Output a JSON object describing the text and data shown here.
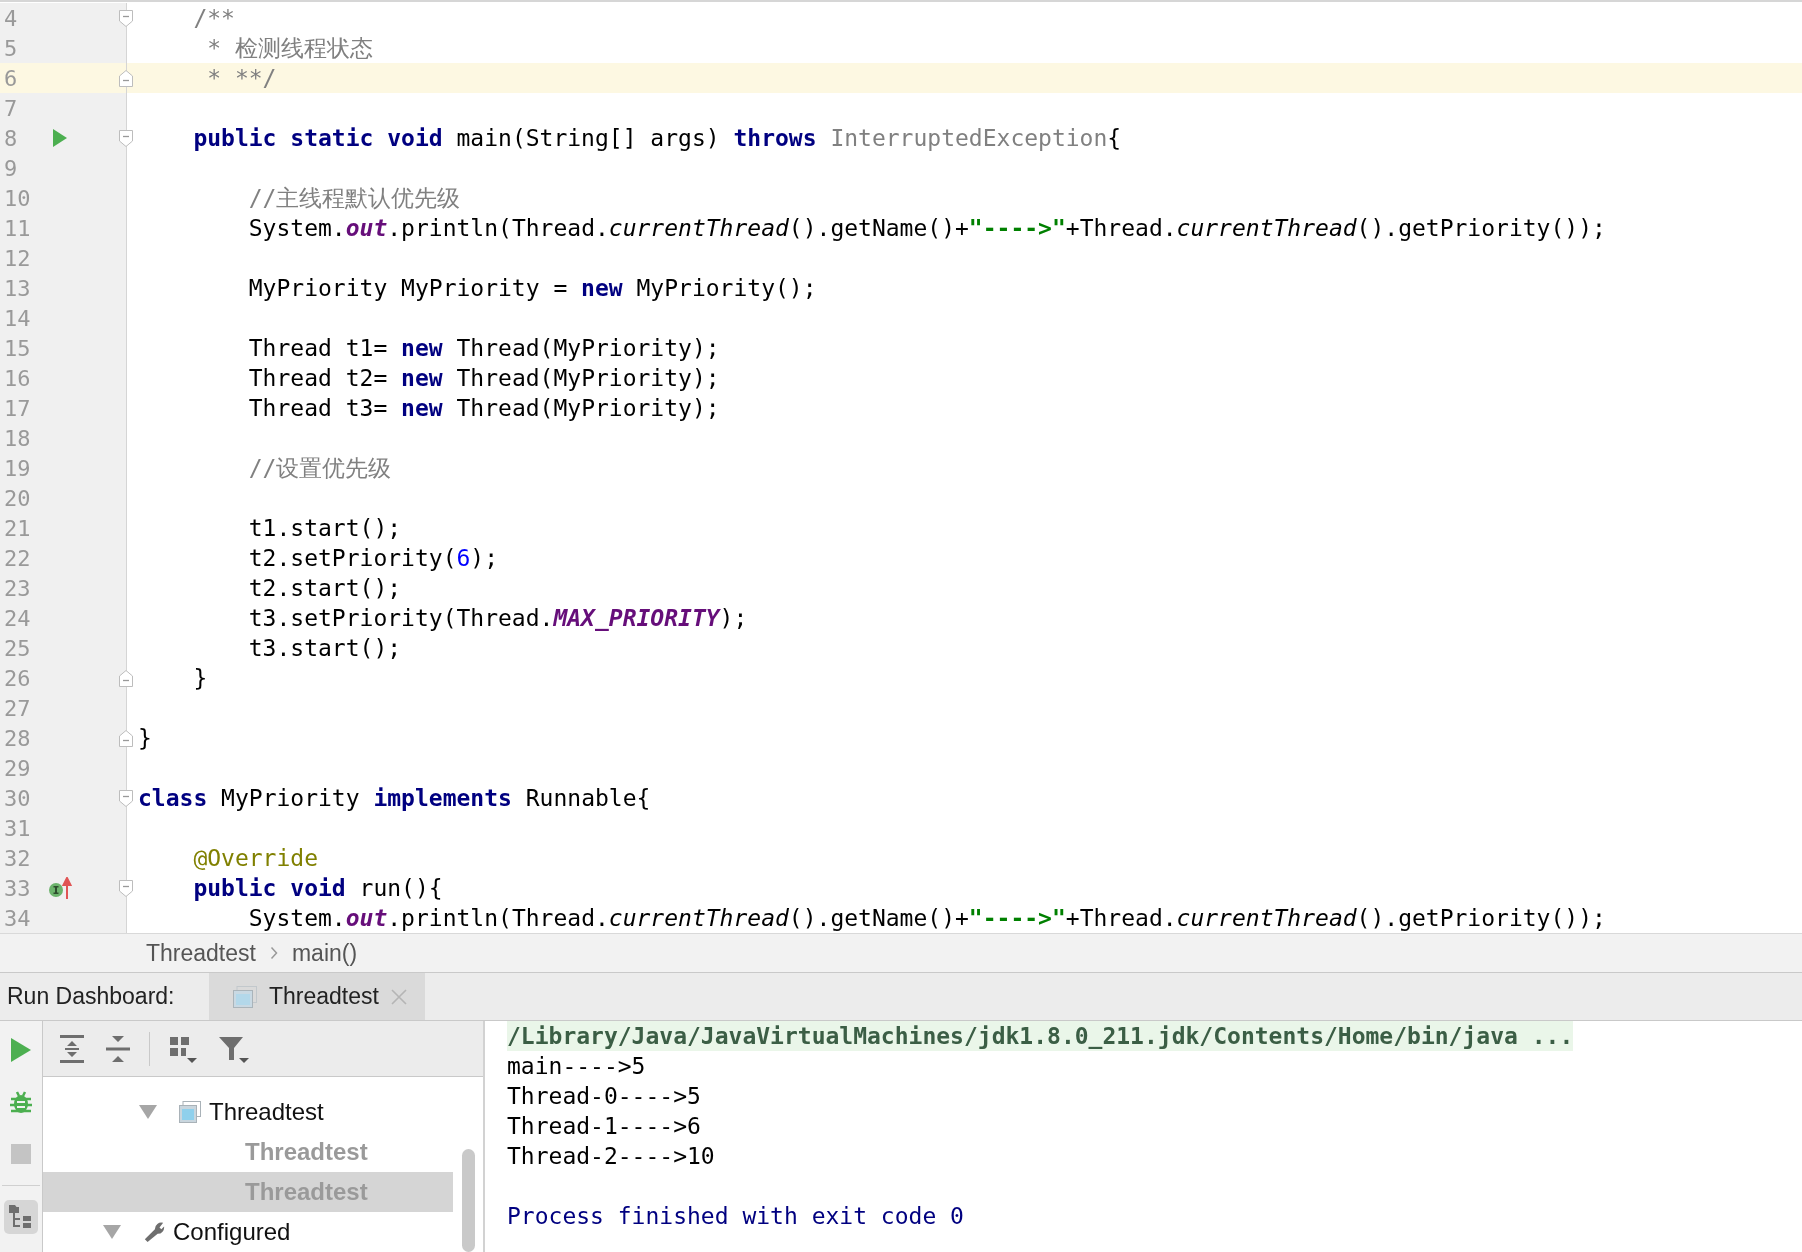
{
  "editor": {
    "lines": [
      {
        "number": "4",
        "fold_start": true,
        "fold_end": false,
        "run_marker": false,
        "implements_marker": false,
        "current": false,
        "tokens": [
          {
            "kind": "comment",
            "text": "    /**"
          }
        ]
      },
      {
        "number": "5",
        "fold_start": false,
        "fold_end": false,
        "run_marker": false,
        "implements_marker": false,
        "current": false,
        "tokens": [
          {
            "kind": "comment",
            "text": "     * 检测线程状态"
          }
        ]
      },
      {
        "number": "6",
        "fold_start": false,
        "fold_end": true,
        "run_marker": false,
        "implements_marker": false,
        "current": true,
        "tokens": [
          {
            "kind": "comment",
            "text": "     * **/"
          }
        ]
      },
      {
        "number": "7",
        "fold_start": false,
        "fold_end": false,
        "run_marker": false,
        "implements_marker": false,
        "current": false
      },
      {
        "number": "8",
        "fold_start": true,
        "fold_end": false,
        "run_marker": true,
        "implements_marker": false,
        "current": false,
        "tokens": [
          {
            "kind": "keyword",
            "text": "    public static void"
          },
          {
            "kind": "plain",
            "text": " main(String[] args) "
          },
          {
            "kind": "keyword",
            "text": "throws "
          },
          {
            "kind": "unused",
            "text": "InterruptedException"
          },
          {
            "kind": "plain",
            "text": "{"
          }
        ]
      },
      {
        "number": "9",
        "fold_start": false,
        "fold_end": false,
        "run_marker": false,
        "implements_marker": false,
        "current": false
      },
      {
        "number": "10",
        "fold_start": false,
        "fold_end": false,
        "run_marker": false,
        "implements_marker": false,
        "current": false,
        "tokens": [
          {
            "kind": "comment",
            "text": "        //主线程默认优先级"
          }
        ]
      },
      {
        "number": "11",
        "fold_start": false,
        "fold_end": false,
        "run_marker": false,
        "implements_marker": false,
        "current": false,
        "tokens": [
          {
            "kind": "plain",
            "text": "        System."
          },
          {
            "kind": "field",
            "text": "out"
          },
          {
            "kind": "plain",
            "text": ".println(Thread."
          },
          {
            "kind": "static",
            "text": "currentThread"
          },
          {
            "kind": "plain",
            "text": "().getName()+"
          },
          {
            "kind": "string",
            "text": "\"---->\""
          },
          {
            "kind": "plain",
            "text": "+Thread."
          },
          {
            "kind": "static",
            "text": "currentThread"
          },
          {
            "kind": "plain",
            "text": "().getPriority());"
          }
        ]
      },
      {
        "number": "12",
        "fold_start": false,
        "fold_end": false,
        "run_marker": false,
        "implements_marker": false,
        "current": false
      },
      {
        "number": "13",
        "fold_start": false,
        "fold_end": false,
        "run_marker": false,
        "implements_marker": false,
        "current": false,
        "tokens": [
          {
            "kind": "plain",
            "text": "        MyPriority MyPriority = "
          },
          {
            "kind": "keyword",
            "text": "new"
          },
          {
            "kind": "plain",
            "text": " MyPriority();"
          }
        ]
      },
      {
        "number": "14",
        "fold_start": false,
        "fold_end": false,
        "run_marker": false,
        "implements_marker": false,
        "current": false
      },
      {
        "number": "15",
        "fold_start": false,
        "fold_end": false,
        "run_marker": false,
        "implements_marker": false,
        "current": false,
        "tokens": [
          {
            "kind": "plain",
            "text": "        Thread t1= "
          },
          {
            "kind": "keyword",
            "text": "new"
          },
          {
            "kind": "plain",
            "text": " Thread(MyPriority);"
          }
        ]
      },
      {
        "number": "16",
        "fold_start": false,
        "fold_end": false,
        "run_marker": false,
        "implements_marker": false,
        "current": false,
        "tokens": [
          {
            "kind": "plain",
            "text": "        Thread t2= "
          },
          {
            "kind": "keyword",
            "text": "new"
          },
          {
            "kind": "plain",
            "text": " Thread(MyPriority);"
          }
        ]
      },
      {
        "number": "17",
        "fold_start": false,
        "fold_end": false,
        "run_marker": false,
        "implements_marker": false,
        "current": false,
        "tokens": [
          {
            "kind": "plain",
            "text": "        Thread t3= "
          },
          {
            "kind": "keyword",
            "text": "new"
          },
          {
            "kind": "plain",
            "text": " Thread(MyPriority);"
          }
        ]
      },
      {
        "number": "18",
        "fold_start": false,
        "fold_end": false,
        "run_marker": false,
        "implements_marker": false,
        "current": false
      },
      {
        "number": "19",
        "fold_start": false,
        "fold_end": false,
        "run_marker": false,
        "implements_marker": false,
        "current": false,
        "tokens": [
          {
            "kind": "comment",
            "text": "        //设置优先级"
          }
        ]
      },
      {
        "number": "20",
        "fold_start": false,
        "fold_end": false,
        "run_marker": false,
        "implements_marker": false,
        "current": false
      },
      {
        "number": "21",
        "fold_start": false,
        "fold_end": false,
        "run_marker": false,
        "implements_marker": false,
        "current": false,
        "tokens": [
          {
            "kind": "plain",
            "text": "        t1.start();"
          }
        ]
      },
      {
        "number": "22",
        "fold_start": false,
        "fold_end": false,
        "run_marker": false,
        "implements_marker": false,
        "current": false,
        "tokens": [
          {
            "kind": "plain",
            "text": "        t2.setPriority("
          },
          {
            "kind": "number",
            "text": "6"
          },
          {
            "kind": "plain",
            "text": ");"
          }
        ]
      },
      {
        "number": "23",
        "fold_start": false,
        "fold_end": false,
        "run_marker": false,
        "implements_marker": false,
        "current": false,
        "tokens": [
          {
            "kind": "plain",
            "text": "        t2.start();"
          }
        ]
      },
      {
        "number": "24",
        "fold_start": false,
        "fold_end": false,
        "run_marker": false,
        "implements_marker": false,
        "current": false,
        "tokens": [
          {
            "kind": "plain",
            "text": "        t3.setPriority(Thread."
          },
          {
            "kind": "field",
            "text": "MAX_PRIORITY"
          },
          {
            "kind": "plain",
            "text": ");"
          }
        ]
      },
      {
        "number": "25",
        "fold_start": false,
        "fold_end": false,
        "run_marker": false,
        "implements_marker": false,
        "current": false,
        "tokens": [
          {
            "kind": "plain",
            "text": "        t3.start();"
          }
        ]
      },
      {
        "number": "26",
        "fold_start": false,
        "fold_end": true,
        "run_marker": false,
        "implements_marker": false,
        "current": false,
        "tokens": [
          {
            "kind": "plain",
            "text": "    }"
          }
        ]
      },
      {
        "number": "27",
        "fold_start": false,
        "fold_end": false,
        "run_marker": false,
        "implements_marker": false,
        "current": false
      },
      {
        "number": "28",
        "fold_start": false,
        "fold_end": true,
        "run_marker": false,
        "implements_marker": false,
        "current": false,
        "tokens": [
          {
            "kind": "plain",
            "text": "}"
          }
        ]
      },
      {
        "number": "29",
        "fold_start": false,
        "fold_end": false,
        "run_marker": false,
        "implements_marker": false,
        "current": false
      },
      {
        "number": "30",
        "fold_start": true,
        "fold_end": false,
        "run_marker": false,
        "implements_marker": false,
        "current": false,
        "tokens": [
          {
            "kind": "keyword",
            "text": "class"
          },
          {
            "kind": "plain",
            "text": " MyPriority "
          },
          {
            "kind": "keyword",
            "text": "implements"
          },
          {
            "kind": "plain",
            "text": " Runnable{"
          }
        ]
      },
      {
        "number": "31",
        "fold_start": false,
        "fold_end": false,
        "run_marker": false,
        "implements_marker": false,
        "current": false
      },
      {
        "number": "32",
        "fold_start": false,
        "fold_end": false,
        "run_marker": false,
        "implements_marker": false,
        "current": false,
        "tokens": [
          {
            "kind": "annotation",
            "text": "    @Override"
          }
        ]
      },
      {
        "number": "33",
        "fold_start": true,
        "fold_end": false,
        "run_marker": false,
        "implements_marker": true,
        "current": false,
        "tokens": [
          {
            "kind": "keyword",
            "text": "    public void"
          },
          {
            "kind": "plain",
            "text": " run(){"
          }
        ]
      },
      {
        "number": "34",
        "fold_start": false,
        "fold_end": false,
        "run_marker": false,
        "implements_marker": false,
        "current": false,
        "tokens": [
          {
            "kind": "plain",
            "text": "        System."
          },
          {
            "kind": "field",
            "text": "out"
          },
          {
            "kind": "plain",
            "text": ".println(Thread."
          },
          {
            "kind": "static",
            "text": "currentThread"
          },
          {
            "kind": "plain",
            "text": "().getName()+"
          },
          {
            "kind": "string",
            "text": "\"---->\""
          },
          {
            "kind": "plain",
            "text": "+Thread."
          },
          {
            "kind": "static",
            "text": "currentThread"
          },
          {
            "kind": "plain",
            "text": "().getPriority());"
          }
        ]
      }
    ]
  },
  "breadcrumb": [
    "Threadtest",
    "main()"
  ],
  "run_dashboard": {
    "title": "Run Dashboard:",
    "tabs": [
      {
        "label": "Threadtest",
        "selected": true
      }
    ],
    "side_toolbar": [
      {
        "kind": "run",
        "disabled": false,
        "on": false
      },
      {
        "kind": "debug",
        "disabled": false,
        "on": false
      },
      {
        "kind": "stop",
        "disabled": true,
        "on": false
      },
      {
        "kind": "tree-view",
        "disabled": false,
        "on": true
      }
    ],
    "tree_toolbar": [
      {
        "kind": "expand-all",
        "separated": false
      },
      {
        "kind": "collapse-all",
        "separated": false
      },
      {
        "kind": "group",
        "separated": true
      },
      {
        "kind": "filter",
        "separated": false
      }
    ],
    "tree": {
      "scrolled_group_children": [
        {
          "label": "Threadtest",
          "kind": "application",
          "expanded": true,
          "disabled": false,
          "selected": false,
          "children": [
            {
              "label": "Threadtest",
              "disabled": true,
              "selected": false
            },
            {
              "label": "Threadtest",
              "disabled": true,
              "selected": true
            }
          ]
        }
      ],
      "items": [
        {
          "label": "Configured",
          "kind": "configured",
          "expanded": true,
          "disabled": false,
          "selected": false
        }
      ]
    },
    "console": [
      {
        "kind": "command",
        "text": "/Library/Java/JavaVirtualMachines/jdk1.8.0_211.jdk/Contents/Home/bin/java ..."
      },
      {
        "kind": "output",
        "text": "main---->5"
      },
      {
        "kind": "output",
        "text": "Thread-0---->5"
      },
      {
        "kind": "output",
        "text": "Thread-1---->6"
      },
      {
        "kind": "output",
        "text": "Thread-2---->10"
      },
      {
        "kind": "exit",
        "text": "Process finished with exit code 0"
      }
    ]
  }
}
